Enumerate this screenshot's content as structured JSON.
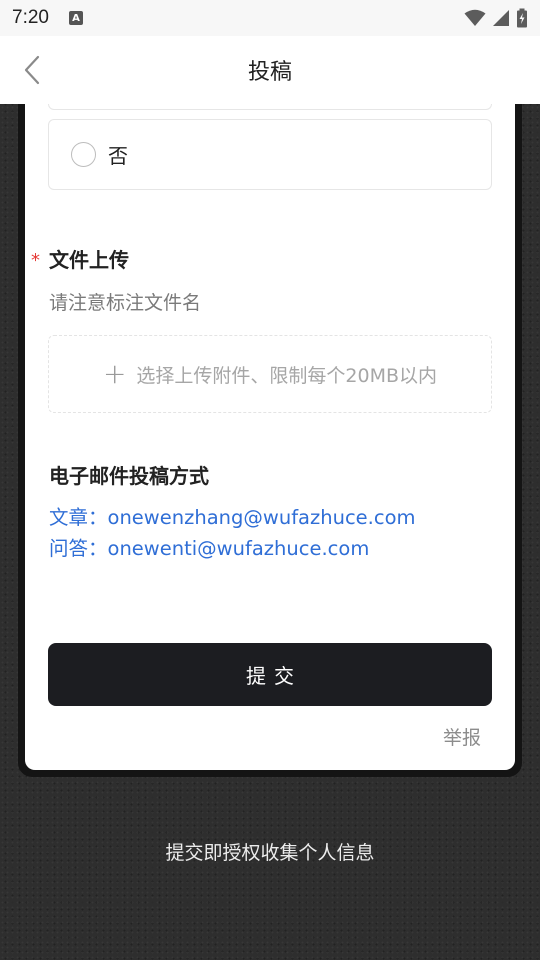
{
  "status_bar": {
    "time": "7:20",
    "notification_icon": "A"
  },
  "nav": {
    "title": "投稿"
  },
  "form": {
    "previous_option_label": "",
    "option_no_label": "否",
    "upload_section": {
      "required_mark": "*",
      "title": "文件上传",
      "hint": "请注意标注文件名",
      "upload_plus": "+",
      "upload_text": "选择上传附件、限制每个20MB以内"
    },
    "email_section": {
      "title": "电子邮件投稿方式",
      "article_prefix": "文章：",
      "article_email": "onewenzhang@wufazhuce.com",
      "qa_prefix": "问答：",
      "qa_email": "onewenti@wufazhuce.com"
    },
    "submit_label": "提交",
    "report_label": "举报"
  },
  "footer": {
    "note": "提交即授权收集个人信息"
  },
  "colors": {
    "link": "#2f6ed6",
    "required": "#e53935",
    "button_bg": "#1c1d21",
    "page_bg": "#2e2e2e"
  },
  "icons": [
    "back-chevron-icon",
    "wifi-icon",
    "signal-icon",
    "battery-icon",
    "radio-unchecked-icon",
    "plus-icon"
  ]
}
